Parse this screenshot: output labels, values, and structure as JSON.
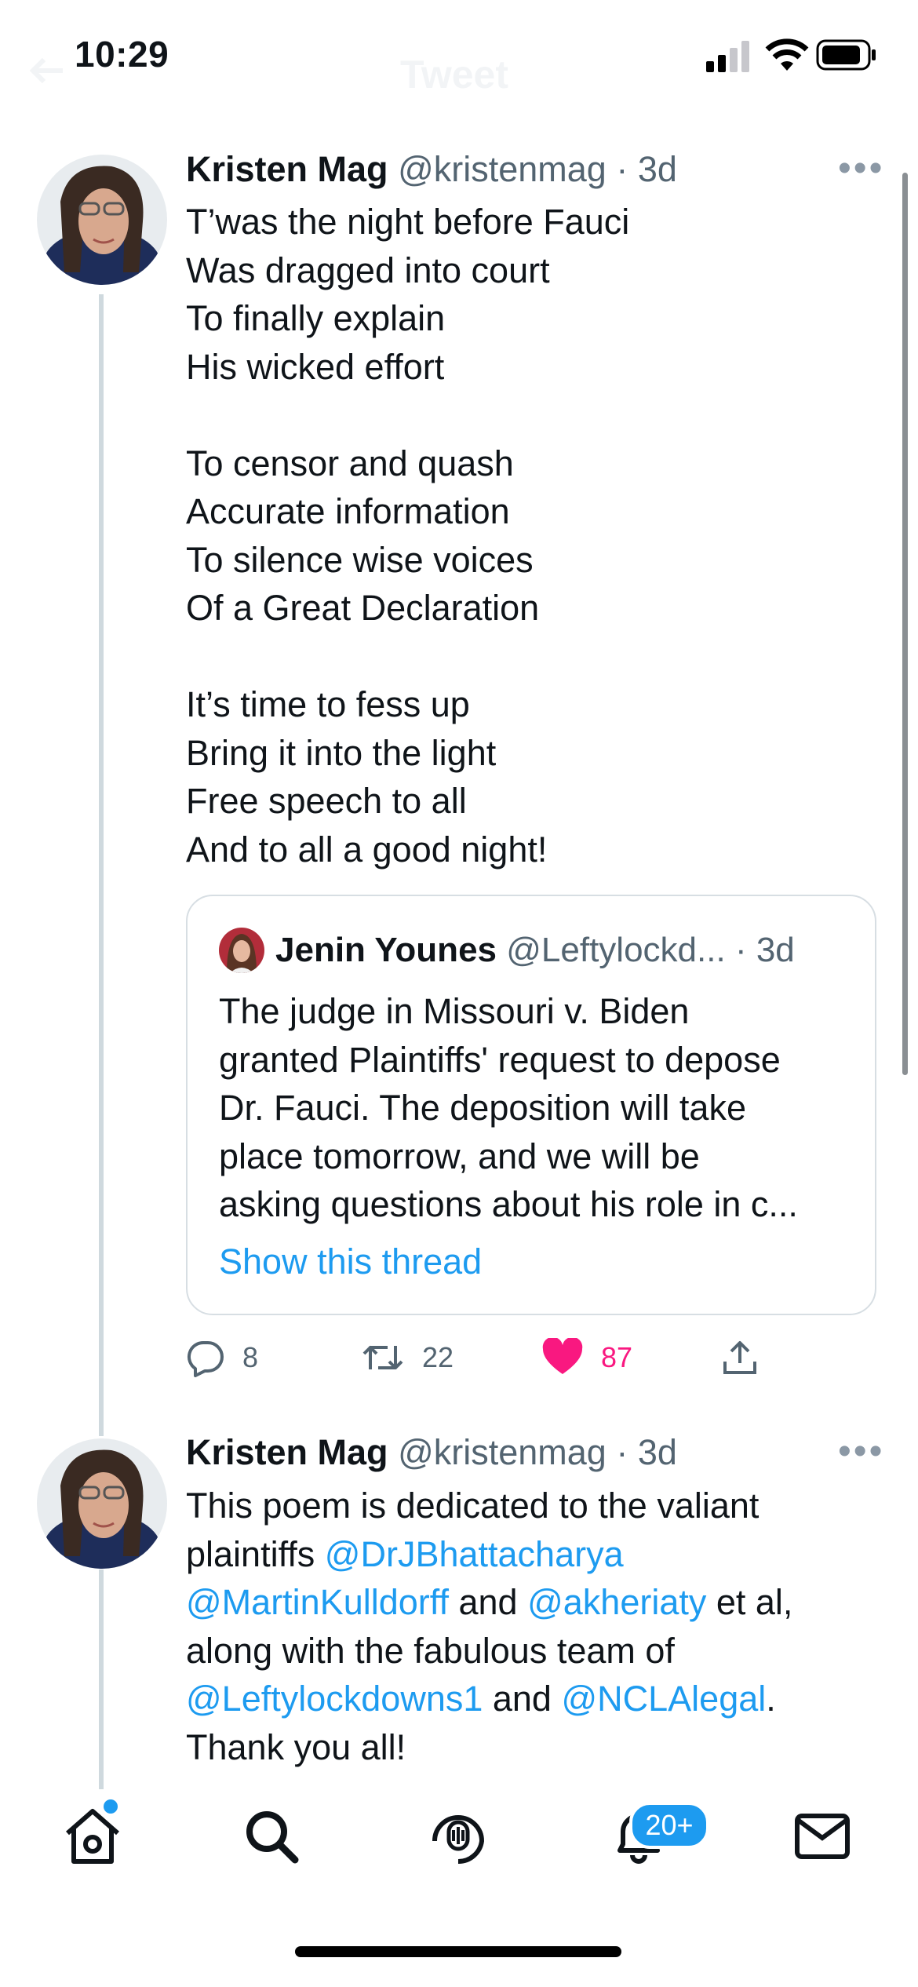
{
  "status_bar": {
    "time": "10:29"
  },
  "nav": {
    "title": "Tweet"
  },
  "tweets": [
    {
      "name": "Kristen Mag",
      "handle": "@kristenmag",
      "time": "· 3d",
      "text": "T’was the night before Fauci\nWas dragged into court\nTo finally explain\nHis wicked effort\n\nTo censor and quash\nAccurate information\nTo silence wise voices\nOf a Great Declaration\n\nIt’s time to fess up\nBring it into the light\nFree speech to all\nAnd to all a good night!",
      "quote": {
        "name": "Jenin Younes",
        "handle": "@Leftylockd...",
        "time": "· 3d",
        "text": "The judge in Missouri v. Biden\ngranted Plaintiffs' request to depose\nDr. Fauci.  The deposition will take\nplace tomorrow, and we will be\nasking questions about his role in c...",
        "link": "Show this thread"
      },
      "replies": "8",
      "retweets": "22",
      "likes": "87"
    },
    {
      "name": "Kristen Mag",
      "handle": "@kristenmag",
      "time": "· 3d",
      "text_parts": {
        "t1": "This poem is dedicated to the valiant",
        "t2": "plaintiffs ",
        "m1": "@DrJBhattacharya",
        "m2": "@MartinKulldorff",
        "t3": " and ",
        "m3": "@akheriaty",
        "t4": " et al,",
        "t5": "along with the fabulous team of",
        "m4": "@Leftylockdowns1",
        "t6": " and ",
        "m5": "@NCLAlegal",
        "t7": ".",
        "t8": "Thank you all!"
      }
    }
  ],
  "tab_bar": {
    "items": [
      "home-icon",
      "search-icon",
      "spaces-icon",
      "notifications-icon",
      "messages-icon"
    ],
    "notifications_badge": "20+"
  },
  "colors": {
    "accent": "#1d9bf0",
    "like": "#f91880",
    "text": "#0f1419",
    "secondary": "#536471"
  }
}
